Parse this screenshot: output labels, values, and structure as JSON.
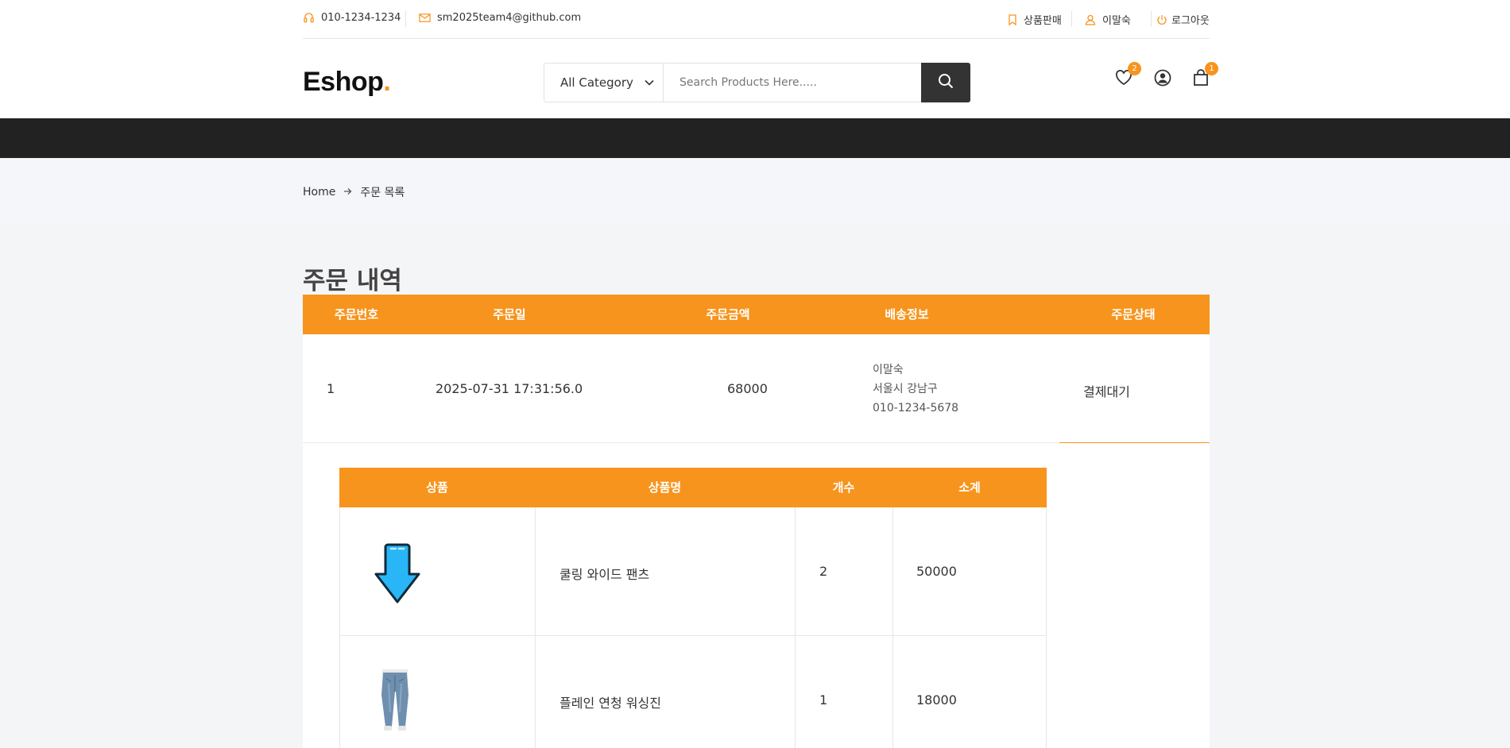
{
  "topbar": {
    "phone": "010-1234-1234",
    "email": "sm2025team4@github.com",
    "sell_label": "상품판매",
    "user_label": "이말숙",
    "logout_label": "로그아웃"
  },
  "header": {
    "logo_text": "Eshop",
    "logo_dot": ".",
    "category_label": "All Category",
    "search_placeholder": "Search Products Here.....",
    "wishlist_count": "2",
    "cart_count": "1"
  },
  "breadcrumb": {
    "home": "Home",
    "current": "주문 목록"
  },
  "page_title": "주문 내역",
  "orders": {
    "columns": [
      "주문번호",
      "주문일",
      "주문금액",
      "배송정보",
      "주문상태"
    ],
    "rows": [
      {
        "order_no": "1",
        "date": "2025-07-31 17:31:56.0",
        "amount": "68000",
        "ship_name": "이말숙",
        "ship_address": "서울시 강남구",
        "ship_phone": "010-1234-5678",
        "status": "결제대기"
      }
    ]
  },
  "order_items": {
    "columns": [
      "상품",
      "상품명",
      "개수",
      "소계"
    ],
    "rows": [
      {
        "image": "download-arrow-icon",
        "name": "쿨링 와이드 팬츠",
        "qty": "2",
        "subtotal": "50000"
      },
      {
        "image": "jeans-product-image",
        "name": "플레인 연청 워싱진",
        "qty": "1",
        "subtotal": "18000"
      }
    ]
  },
  "colors": {
    "accent": "#f7941d",
    "dark": "#222222"
  }
}
